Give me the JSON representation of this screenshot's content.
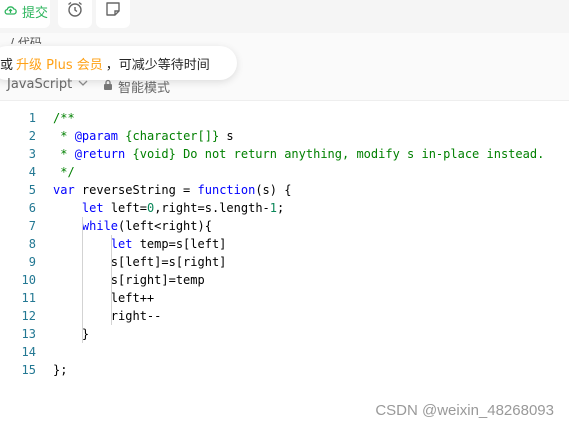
{
  "toolbar": {
    "submit_label": "提交",
    "submit_icon": "cloud-upload-icon",
    "clock_icon": "alarm-clock-icon",
    "note_icon": "note-icon"
  },
  "tooltip": {
    "prefix": "或",
    "highlight": "升级 Plus 会员",
    "suffix": "，可减少等待时间"
  },
  "editor_header": {
    "language": "JavaScript",
    "mode_label": "智能模式"
  },
  "colors": {
    "accent_green": "#2db55d",
    "plus_orange": "#ffa116",
    "keyword_blue": "#0000ff",
    "comment_green": "#008000",
    "line_number": "#237893"
  },
  "code": {
    "lines": [
      {
        "n": "1",
        "tokens": [
          {
            "t": "/**",
            "c": "comment"
          }
        ]
      },
      {
        "n": "2",
        "tokens": [
          {
            "t": " * ",
            "c": "comment"
          },
          {
            "t": "@param",
            "c": "doctag"
          },
          {
            "t": " {character[]} ",
            "c": "doctype"
          },
          {
            "t": "s",
            "c": "plain"
          }
        ]
      },
      {
        "n": "3",
        "tokens": [
          {
            "t": " * ",
            "c": "comment"
          },
          {
            "t": "@return",
            "c": "doctag"
          },
          {
            "t": " {void} ",
            "c": "doctype"
          },
          {
            "t": "Do not return anything, modify s in-place instead.",
            "c": "comment"
          }
        ]
      },
      {
        "n": "4",
        "tokens": [
          {
            "t": " */",
            "c": "comment"
          }
        ]
      },
      {
        "n": "5",
        "tokens": [
          {
            "t": "var",
            "c": "keyword"
          },
          {
            "t": " reverseString = ",
            "c": "plain"
          },
          {
            "t": "function",
            "c": "keyword"
          },
          {
            "t": "(s) {",
            "c": "plain"
          }
        ]
      },
      {
        "n": "6",
        "tokens": [
          {
            "t": "    ",
            "c": "plain"
          },
          {
            "t": "let",
            "c": "keyword"
          },
          {
            "t": " left=",
            "c": "plain"
          },
          {
            "t": "0",
            "c": "number"
          },
          {
            "t": ",right=s.length-",
            "c": "plain"
          },
          {
            "t": "1",
            "c": "number"
          },
          {
            "t": ";",
            "c": "plain"
          }
        ]
      },
      {
        "n": "7",
        "tokens": [
          {
            "t": "    ",
            "c": "plain"
          },
          {
            "t": "while",
            "c": "keyword"
          },
          {
            "t": "(left<right){",
            "c": "plain"
          }
        ]
      },
      {
        "n": "8",
        "tokens": [
          {
            "t": "        ",
            "c": "plain"
          },
          {
            "t": "let",
            "c": "keyword"
          },
          {
            "t": " temp=s[left]",
            "c": "plain"
          }
        ]
      },
      {
        "n": "9",
        "tokens": [
          {
            "t": "        s[left]=s[right]",
            "c": "plain"
          }
        ]
      },
      {
        "n": "10",
        "tokens": [
          {
            "t": "        s[right]=temp",
            "c": "plain"
          }
        ]
      },
      {
        "n": "11",
        "tokens": [
          {
            "t": "        left++",
            "c": "plain"
          }
        ]
      },
      {
        "n": "12",
        "tokens": [
          {
            "t": "        right--",
            "c": "plain"
          }
        ]
      },
      {
        "n": "13",
        "tokens": [
          {
            "t": "    }",
            "c": "plain"
          }
        ]
      },
      {
        "n": "14",
        "tokens": [
          {
            "t": "",
            "c": "plain"
          }
        ]
      },
      {
        "n": "15",
        "tokens": [
          {
            "t": "};",
            "c": "plain"
          }
        ]
      }
    ]
  },
  "watermark": "CSDN @weixin_48268093"
}
